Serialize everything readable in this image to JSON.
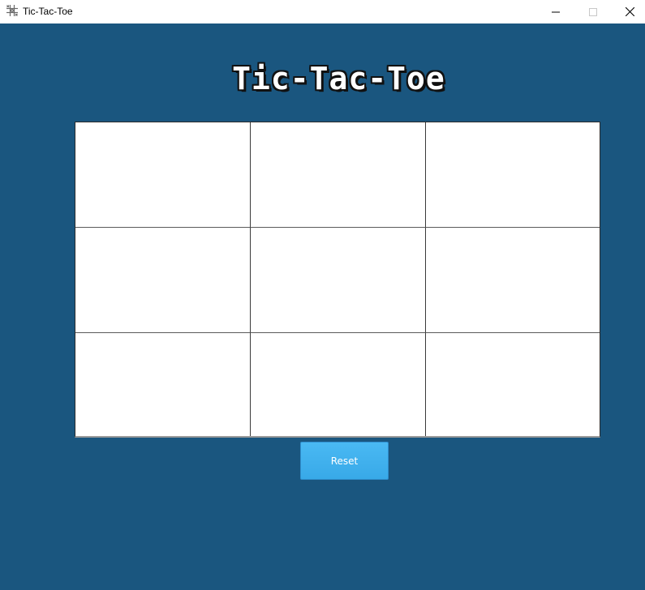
{
  "window": {
    "title": "Tic-Tac-Toe",
    "icon": "tic-tac-toe-grid-icon",
    "controls": [
      "minimize-icon",
      "maximize-icon",
      "close-icon"
    ]
  },
  "game": {
    "title": "Tic-Tac-Toe",
    "board": [
      [
        "",
        "",
        ""
      ],
      [
        "",
        "",
        ""
      ],
      [
        "",
        "",
        ""
      ]
    ],
    "reset_label": "Reset"
  },
  "colors": {
    "background": "#1a567f",
    "reset_button": "#3fb0ed",
    "board": "#ffffff",
    "title_text": "#ffffff",
    "title_outline": "#111111"
  }
}
